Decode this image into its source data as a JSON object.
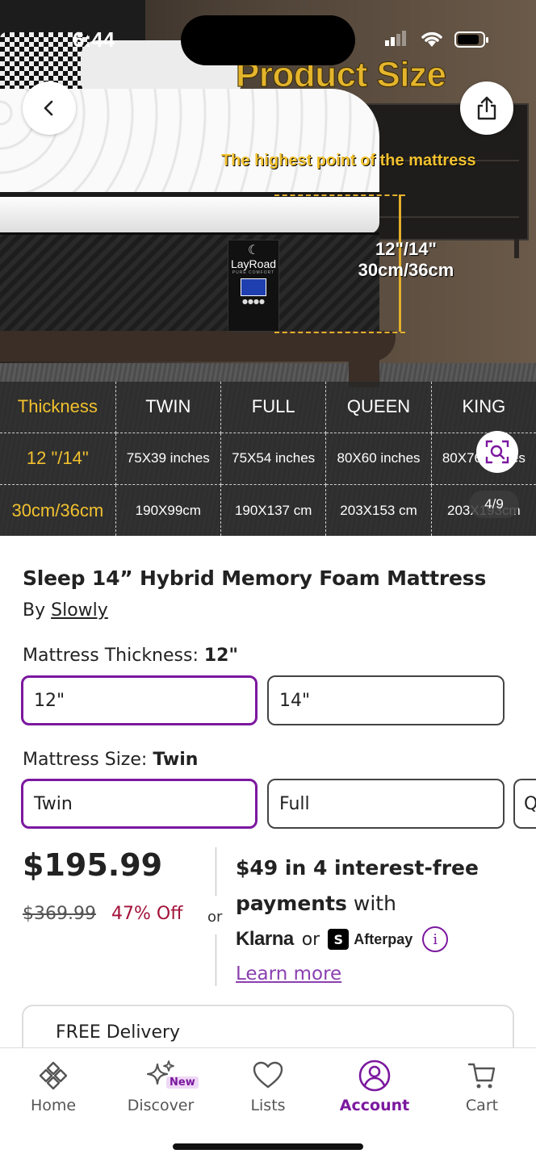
{
  "status_bar": {
    "time": "6:44"
  },
  "hero": {
    "title": "Product Size",
    "subtitle": "The highest point of the mattress",
    "dimension_in": "12\"/14\"",
    "dimension_cm": "30cm/36cm",
    "badge_brand": "LayRoad",
    "badge_tag": "PURE COMFORT",
    "counter": "4/9",
    "size_table": {
      "header": [
        "Thickness",
        "TWIN",
        "FULL",
        "QUEEN",
        "KING"
      ],
      "rows": [
        [
          "12 \"/14\"",
          "75X39 inches",
          "75X54 inches",
          "80X60 inches",
          "80X76 inches"
        ],
        [
          "30cm/36cm",
          "190X99cm",
          "190X137 cm",
          "203X153 cm",
          "203X193cm"
        ]
      ]
    }
  },
  "product": {
    "title": "Sleep 14” Hybrid Memory Foam Mattress",
    "by_prefix": "By",
    "seller": "Slowly"
  },
  "options": {
    "thickness_label": "Mattress Thickness:",
    "thickness_value": "12\"",
    "thickness_choices": [
      "12\"",
      "14\""
    ],
    "size_label": "Mattress Size:",
    "size_value": "Twin",
    "size_choices": [
      "Twin",
      "Full",
      "Q"
    ]
  },
  "pricing": {
    "price": "$195.99",
    "was_price": "$369.99",
    "discount": "47% Off",
    "or": "or",
    "installment_bold": "$49 in 4 interest-free",
    "installment_bold2": "payments",
    "installment_rest": "with",
    "klarna": "Klarna",
    "or2": "or",
    "afterpay_icon": "S",
    "afterpay": "Afterpay",
    "info": "i",
    "learn_more": "Learn more"
  },
  "delivery": {
    "label": "FREE Delivery"
  },
  "nav": {
    "items": [
      {
        "label": "Home"
      },
      {
        "label": "Discover"
      },
      {
        "label": "Lists"
      },
      {
        "label": "Account"
      },
      {
        "label": "Cart"
      }
    ],
    "new_badge": "New"
  },
  "colors": {
    "accent": "#7b189f",
    "discount": "#a3123a",
    "overlay_gold": "#e4b52c"
  }
}
